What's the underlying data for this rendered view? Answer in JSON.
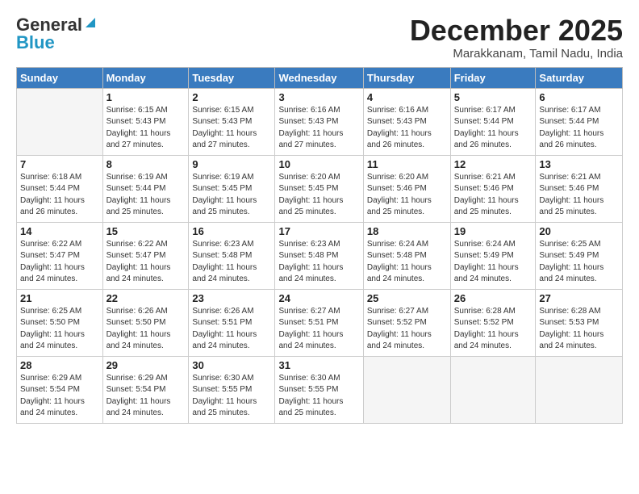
{
  "logo": {
    "line1": "General",
    "line2": "Blue"
  },
  "header": {
    "month": "December 2025",
    "location": "Marakkanam, Tamil Nadu, India"
  },
  "weekdays": [
    "Sunday",
    "Monday",
    "Tuesday",
    "Wednesday",
    "Thursday",
    "Friday",
    "Saturday"
  ],
  "weeks": [
    [
      {
        "day": "",
        "info": ""
      },
      {
        "day": "1",
        "info": "Sunrise: 6:15 AM\nSunset: 5:43 PM\nDaylight: 11 hours\nand 27 minutes."
      },
      {
        "day": "2",
        "info": "Sunrise: 6:15 AM\nSunset: 5:43 PM\nDaylight: 11 hours\nand 27 minutes."
      },
      {
        "day": "3",
        "info": "Sunrise: 6:16 AM\nSunset: 5:43 PM\nDaylight: 11 hours\nand 27 minutes."
      },
      {
        "day": "4",
        "info": "Sunrise: 6:16 AM\nSunset: 5:43 PM\nDaylight: 11 hours\nand 26 minutes."
      },
      {
        "day": "5",
        "info": "Sunrise: 6:17 AM\nSunset: 5:44 PM\nDaylight: 11 hours\nand 26 minutes."
      },
      {
        "day": "6",
        "info": "Sunrise: 6:17 AM\nSunset: 5:44 PM\nDaylight: 11 hours\nand 26 minutes."
      }
    ],
    [
      {
        "day": "7",
        "info": "Sunrise: 6:18 AM\nSunset: 5:44 PM\nDaylight: 11 hours\nand 26 minutes."
      },
      {
        "day": "8",
        "info": "Sunrise: 6:19 AM\nSunset: 5:44 PM\nDaylight: 11 hours\nand 25 minutes."
      },
      {
        "day": "9",
        "info": "Sunrise: 6:19 AM\nSunset: 5:45 PM\nDaylight: 11 hours\nand 25 minutes."
      },
      {
        "day": "10",
        "info": "Sunrise: 6:20 AM\nSunset: 5:45 PM\nDaylight: 11 hours\nand 25 minutes."
      },
      {
        "day": "11",
        "info": "Sunrise: 6:20 AM\nSunset: 5:46 PM\nDaylight: 11 hours\nand 25 minutes."
      },
      {
        "day": "12",
        "info": "Sunrise: 6:21 AM\nSunset: 5:46 PM\nDaylight: 11 hours\nand 25 minutes."
      },
      {
        "day": "13",
        "info": "Sunrise: 6:21 AM\nSunset: 5:46 PM\nDaylight: 11 hours\nand 25 minutes."
      }
    ],
    [
      {
        "day": "14",
        "info": "Sunrise: 6:22 AM\nSunset: 5:47 PM\nDaylight: 11 hours\nand 24 minutes."
      },
      {
        "day": "15",
        "info": "Sunrise: 6:22 AM\nSunset: 5:47 PM\nDaylight: 11 hours\nand 24 minutes."
      },
      {
        "day": "16",
        "info": "Sunrise: 6:23 AM\nSunset: 5:48 PM\nDaylight: 11 hours\nand 24 minutes."
      },
      {
        "day": "17",
        "info": "Sunrise: 6:23 AM\nSunset: 5:48 PM\nDaylight: 11 hours\nand 24 minutes."
      },
      {
        "day": "18",
        "info": "Sunrise: 6:24 AM\nSunset: 5:48 PM\nDaylight: 11 hours\nand 24 minutes."
      },
      {
        "day": "19",
        "info": "Sunrise: 6:24 AM\nSunset: 5:49 PM\nDaylight: 11 hours\nand 24 minutes."
      },
      {
        "day": "20",
        "info": "Sunrise: 6:25 AM\nSunset: 5:49 PM\nDaylight: 11 hours\nand 24 minutes."
      }
    ],
    [
      {
        "day": "21",
        "info": "Sunrise: 6:25 AM\nSunset: 5:50 PM\nDaylight: 11 hours\nand 24 minutes."
      },
      {
        "day": "22",
        "info": "Sunrise: 6:26 AM\nSunset: 5:50 PM\nDaylight: 11 hours\nand 24 minutes."
      },
      {
        "day": "23",
        "info": "Sunrise: 6:26 AM\nSunset: 5:51 PM\nDaylight: 11 hours\nand 24 minutes."
      },
      {
        "day": "24",
        "info": "Sunrise: 6:27 AM\nSunset: 5:51 PM\nDaylight: 11 hours\nand 24 minutes."
      },
      {
        "day": "25",
        "info": "Sunrise: 6:27 AM\nSunset: 5:52 PM\nDaylight: 11 hours\nand 24 minutes."
      },
      {
        "day": "26",
        "info": "Sunrise: 6:28 AM\nSunset: 5:52 PM\nDaylight: 11 hours\nand 24 minutes."
      },
      {
        "day": "27",
        "info": "Sunrise: 6:28 AM\nSunset: 5:53 PM\nDaylight: 11 hours\nand 24 minutes."
      }
    ],
    [
      {
        "day": "28",
        "info": "Sunrise: 6:29 AM\nSunset: 5:54 PM\nDaylight: 11 hours\nand 24 minutes."
      },
      {
        "day": "29",
        "info": "Sunrise: 6:29 AM\nSunset: 5:54 PM\nDaylight: 11 hours\nand 24 minutes."
      },
      {
        "day": "30",
        "info": "Sunrise: 6:30 AM\nSunset: 5:55 PM\nDaylight: 11 hours\nand 25 minutes."
      },
      {
        "day": "31",
        "info": "Sunrise: 6:30 AM\nSunset: 5:55 PM\nDaylight: 11 hours\nand 25 minutes."
      },
      {
        "day": "",
        "info": ""
      },
      {
        "day": "",
        "info": ""
      },
      {
        "day": "",
        "info": ""
      }
    ]
  ]
}
